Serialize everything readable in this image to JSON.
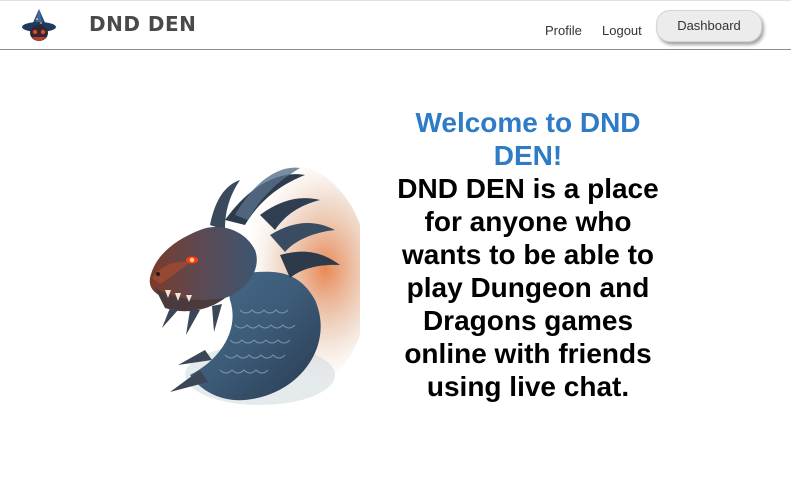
{
  "header": {
    "brand": "DND DEN",
    "nav": {
      "profile": "Profile",
      "logout": "Logout",
      "dashboard": "Dashboard"
    }
  },
  "hero": {
    "title": "Welcome to DND DEN!",
    "description": "DND DEN is a place for anyone who wants to be able to play Dungeon and Dragons games online with friends using live chat."
  },
  "colors": {
    "title": "#2e7bc6",
    "brand": "#4a4a4a",
    "button_bg": "#ececec"
  }
}
